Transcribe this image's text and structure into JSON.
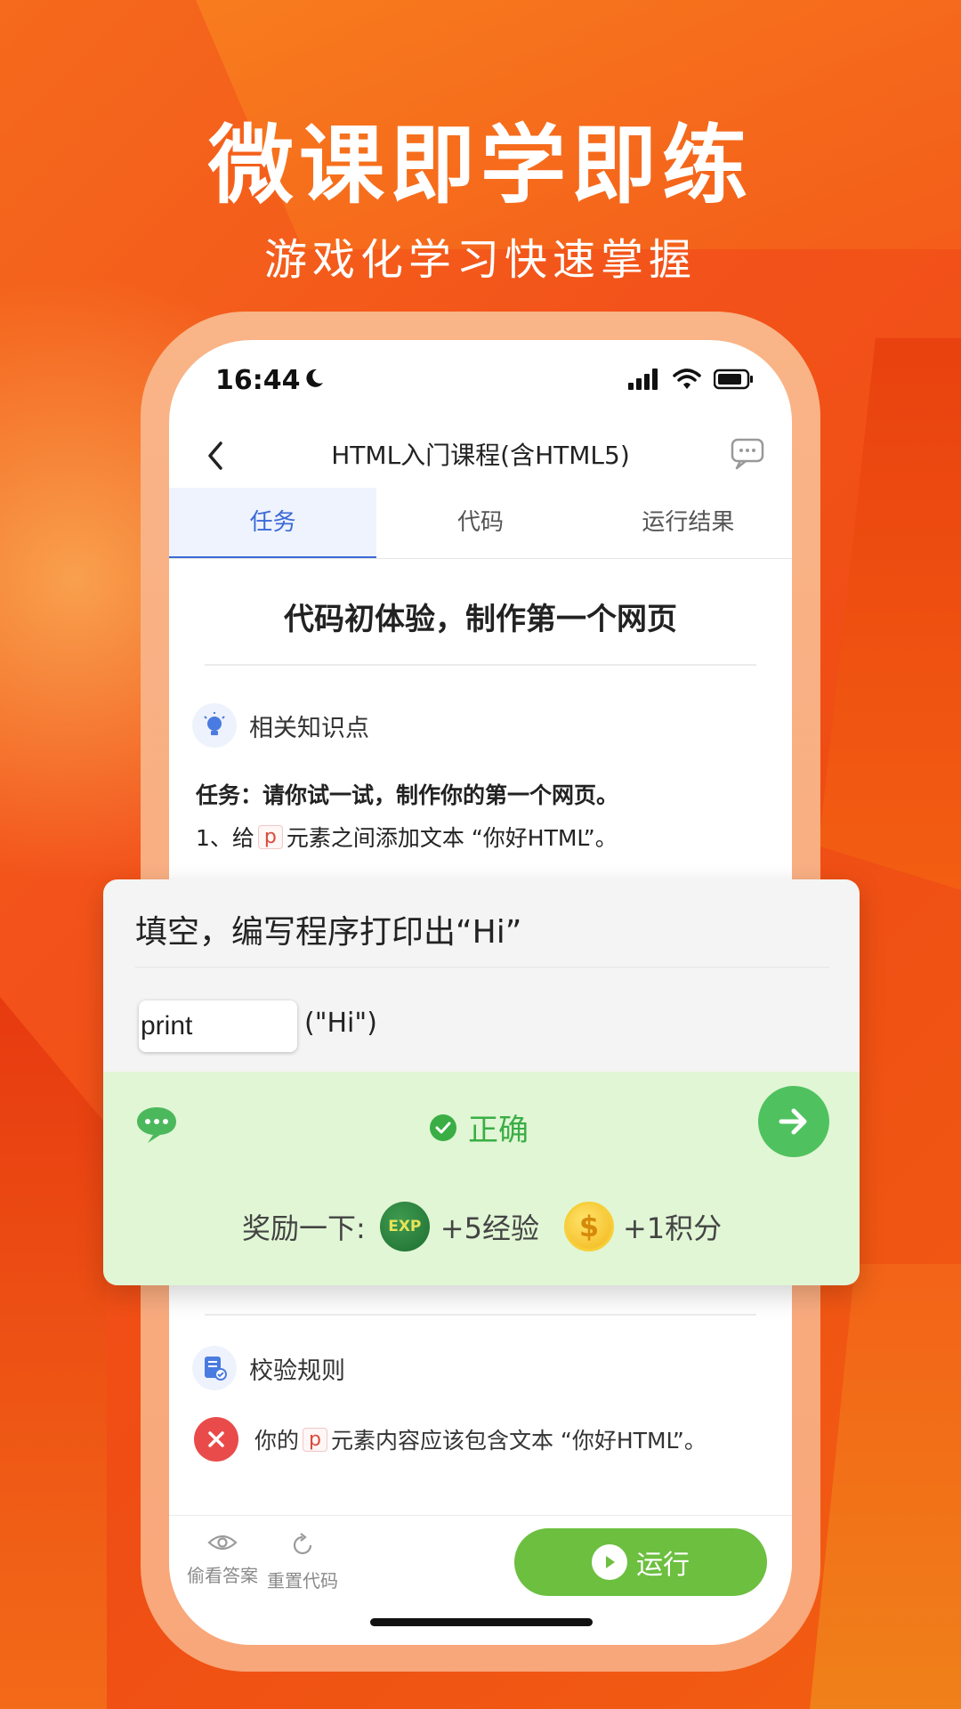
{
  "banner": {
    "headline": "微课即学即练",
    "subline": "游戏化学习快速掌握"
  },
  "status": {
    "time": "16:44"
  },
  "nav": {
    "title": "HTML入门课程(含HTML5)"
  },
  "tabs": [
    {
      "label": "任务",
      "active": true
    },
    {
      "label": "代码",
      "active": false
    },
    {
      "label": "运行结果",
      "active": false
    }
  ],
  "lesson": {
    "title": "代码初体验，制作第一个网页",
    "knowledge_label": "相关知识点",
    "task_text": "任务：请你试一试，制作你的第一个网页。",
    "step1_prefix": "1、给",
    "step1_tag": "p",
    "step1_suffix": "元素之间添加文本 “你好HTML”。"
  },
  "quiz": {
    "question": "填空，编写程序打印出“Hi”",
    "input_value": "print",
    "argument": "(\"Hi\")",
    "result_text": "正确",
    "reward_label": "奖励一下:",
    "exp_badge": "EXP",
    "exp_text": "+5经验",
    "coin_badge": "$",
    "points_text": "+1积分"
  },
  "rules": {
    "label": "校验规则",
    "error_prefix": "你的",
    "error_tag": "p",
    "error_suffix": "元素内容应该包含文本 “你好HTML”。"
  },
  "bottom": {
    "peek_label": "偷看答案",
    "reset_label": "重置代码",
    "run_label": "运行"
  },
  "colors": {
    "accent_blue": "#3b6ad6",
    "correct_green": "#3aae45",
    "run_green": "#6cbf3f",
    "error_red": "#e94b4b"
  }
}
